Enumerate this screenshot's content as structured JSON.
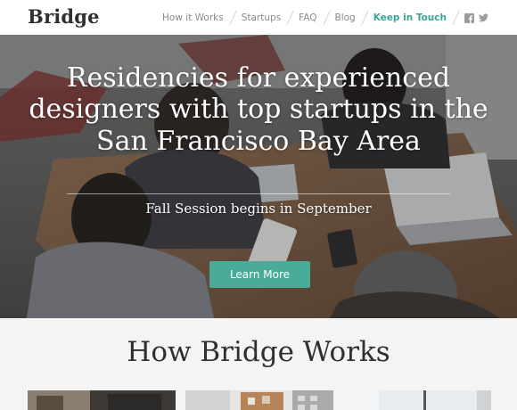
{
  "header": {
    "logo": "Bridge",
    "nav": [
      {
        "label": "How it Works"
      },
      {
        "label": "Startups"
      },
      {
        "label": "FAQ"
      },
      {
        "label": "Blog"
      },
      {
        "label": "Keep in Touch"
      }
    ],
    "social": [
      "facebook-icon",
      "twitter-icon"
    ]
  },
  "hero": {
    "title": "Residencies for experienced designers with top startups in the San Francisco Bay Area",
    "subtitle": "Fall Session begins in September",
    "cta_label": "Learn More"
  },
  "how": {
    "title": "How Bridge Works"
  },
  "colors": {
    "accent": "#4aab9b",
    "nav_active": "#3aa597",
    "text_dark": "#2f2f2f",
    "nav_text": "#8a8a8a"
  }
}
